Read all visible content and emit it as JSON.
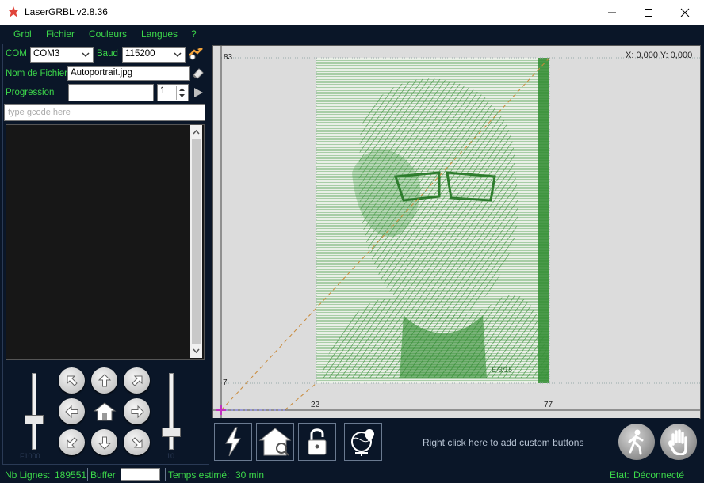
{
  "window": {
    "title": "LaserGRBL v2.8.36",
    "min_label": "–",
    "max_label": "☐",
    "close_label": "✕"
  },
  "menu": [
    "Grbl",
    "Fichier",
    "Couleurs",
    "Langues",
    "?"
  ],
  "connection": {
    "com_label": "COM",
    "com_value": "COM3",
    "baud_label": "Baud",
    "baud_value": "115200"
  },
  "file": {
    "label": "Nom de Fichier",
    "value": "Autoportrait.jpg"
  },
  "progress": {
    "label": "Progression",
    "fraction": 0,
    "copies": "1"
  },
  "gcode_input": {
    "placeholder": "type gcode here"
  },
  "sliders": {
    "left_label": "F1000",
    "right_label": "10"
  },
  "canvas": {
    "coords": "X: 0,000 Y: 0,000",
    "y_top_label": "83",
    "y_bottom_label": "7",
    "x_left_label": "22",
    "x_right_label": "77",
    "image_signature": "E/3/15"
  },
  "toolbar": {
    "custom_hint": "Right click here to add custom buttons"
  },
  "status": {
    "lines_label": "Nb Lignes:",
    "lines_value": "189551",
    "buffer_label": "Buffer",
    "time_label": "Temps estimé:",
    "time_value": "30 min",
    "state_label": "Etat:",
    "state_value": "Déconnecté"
  },
  "colors": {
    "accent_green": "#3cd84a",
    "background": "#0a1628",
    "engraving": "#2e8b2e"
  },
  "icons": [
    "laser-icon",
    "erase-icon",
    "play-icon",
    "arrow-up-left-icon",
    "arrow-up-icon",
    "arrow-up-right-icon",
    "arrow-left-icon",
    "home-icon",
    "arrow-right-icon",
    "arrow-down-left-icon",
    "arrow-down-icon",
    "arrow-down-right-icon",
    "reset-lightning-icon",
    "homing-icon",
    "unlock-icon",
    "globe-icon",
    "walk-icon",
    "hand-stop-icon"
  ]
}
